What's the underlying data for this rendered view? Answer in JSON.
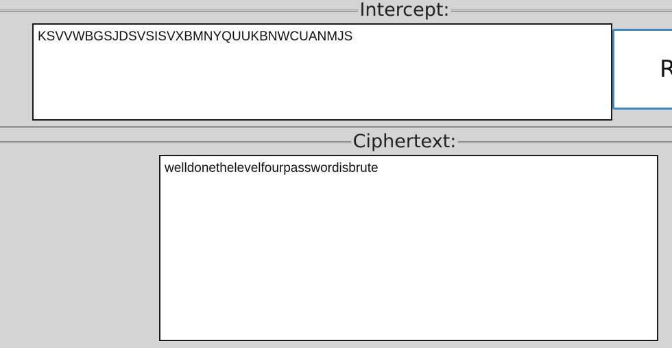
{
  "intercept": {
    "title": "Intercept:",
    "value": "KSVVWBGSJDSVSISVXBMNYQUUKBNWCUANMJS"
  },
  "action_button": {
    "label": "R"
  },
  "ciphertext": {
    "title": "Ciphertext:",
    "value": "welldonethelevelfourpasswordisbrute"
  },
  "colors": {
    "background": "#d4d4d4",
    "button_border": "#3f88bf",
    "box_border": "#1a1a1a"
  }
}
